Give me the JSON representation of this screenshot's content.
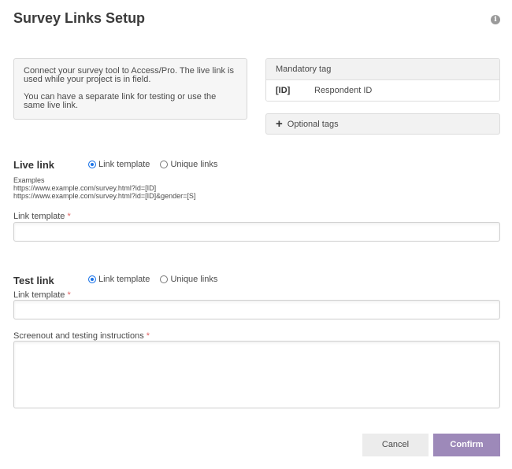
{
  "header": {
    "title": "Survey Links Setup",
    "info_icon": "i"
  },
  "intro": {
    "paragraph1": "Connect your survey tool to Access/Pro. The live link is used while your project is in field.",
    "paragraph2": "You can have a separate link for testing or use the same live link."
  },
  "mandatory_tag": {
    "heading": "Mandatory tag",
    "code": "[ID]",
    "description": "Respondent ID"
  },
  "optional_tags": {
    "icon": "+",
    "label": "Optional tags"
  },
  "live_link": {
    "label": "Live link",
    "options": [
      {
        "label": "Link template",
        "selected": true
      },
      {
        "label": "Unique links",
        "selected": false
      }
    ],
    "examples_heading": "Examples",
    "examples": [
      "https://www.example.com/survey.html?id=[ID]",
      "https://www.example.com/survey.html?id=[ID]&gender=[S]"
    ],
    "field_label": "Link template",
    "required_mark": "*",
    "value": ""
  },
  "test_link": {
    "label": "Test link",
    "options": [
      {
        "label": "Link template",
        "selected": true
      },
      {
        "label": "Unique links",
        "selected": false
      }
    ],
    "field_label": "Link template",
    "required_mark": "*",
    "value": "",
    "instructions_label": "Screenout and testing instructions",
    "instructions_required_mark": "*",
    "instructions_value": ""
  },
  "actions": {
    "cancel_label": "Cancel",
    "confirm_label": "Confirm"
  },
  "colors": {
    "confirm_button": "#9d89b9",
    "radio_selected": "#1a73e8",
    "required": "#e06060"
  }
}
